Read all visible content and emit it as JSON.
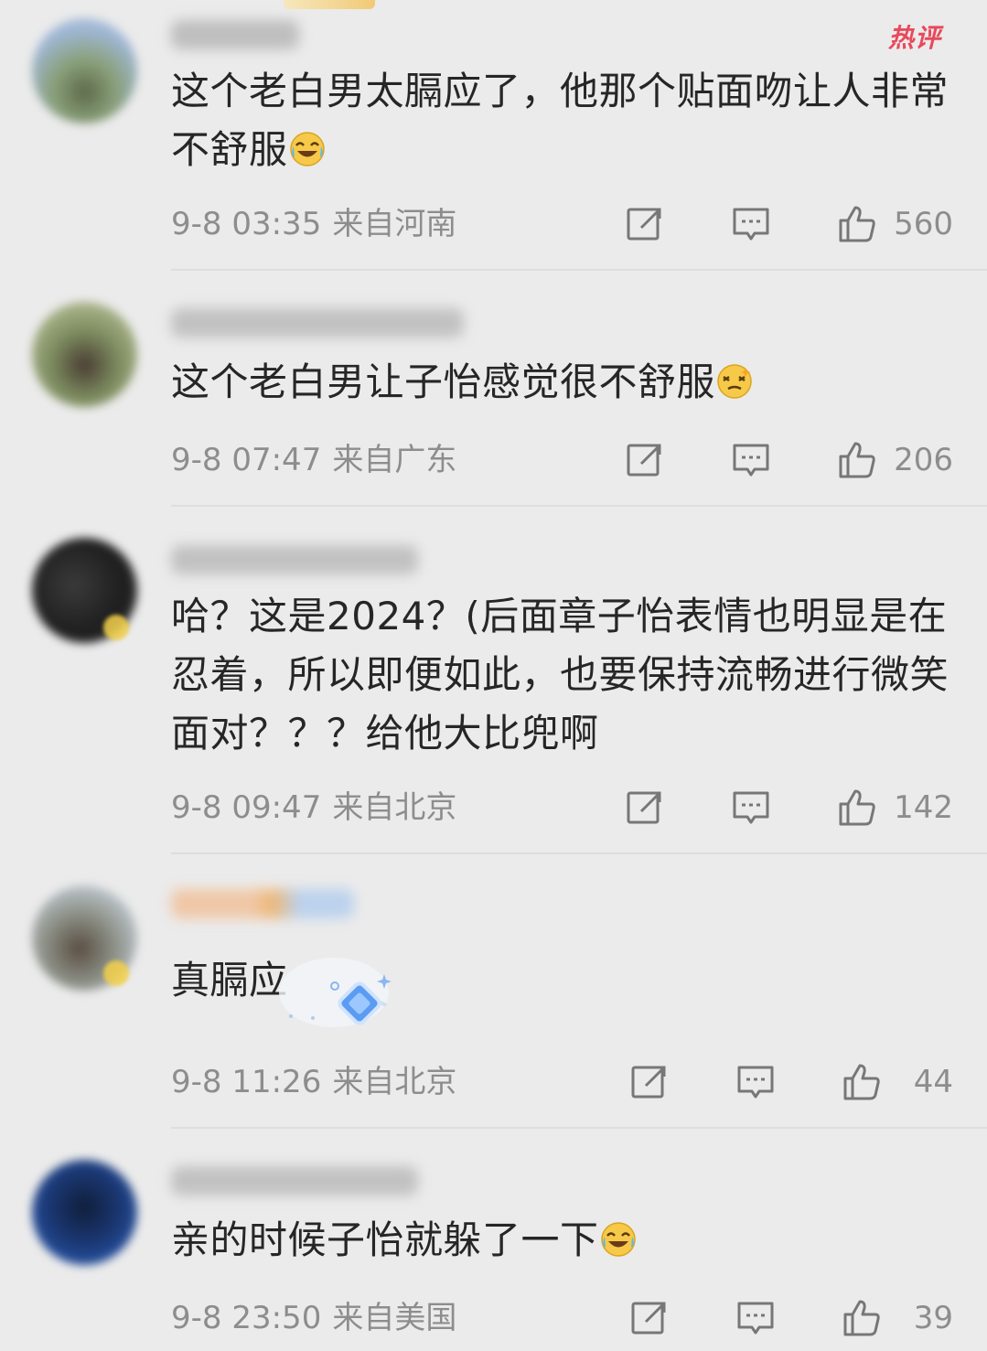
{
  "hot_label": "热评",
  "comments": [
    {
      "text": "这个老白男太膈应了，他那个贴面吻让人非常不舒服",
      "emoji": "laughing-crying-emoji",
      "time": "9-8 03:35",
      "location": "来自河南",
      "likes": "560"
    },
    {
      "text": "这个老白男让子怡感觉很不舒服",
      "emoji": "dizzy-face-emoji",
      "time": "9-8 07:47",
      "location": "来自广东",
      "likes": "206"
    },
    {
      "text": "哈？这是2024？(后面章子怡表情也明显是在忍着，所以即便如此，也要保持流畅进行微笑面对？？？给他大比兜啊",
      "time": "9-8 09:47",
      "location": "来自北京",
      "likes": "142"
    },
    {
      "text": "真膈应",
      "emoji": "diamond-sticker",
      "time": "9-8 11:26",
      "location": "来自北京",
      "likes": "44"
    },
    {
      "text": "亲的时候子怡就躲了一下",
      "emoji": "laughing-crying-emoji",
      "time": "9-8 23:50",
      "location": "来自美国",
      "likes": "39"
    }
  ],
  "icons": {
    "share": "share-icon",
    "reply": "comment-icon",
    "like": "thumbs-up-icon"
  },
  "colors": {
    "background": "#ebebeb",
    "text": "#262626",
    "meta": "#8d8d8d",
    "hot": "#e8495b"
  }
}
